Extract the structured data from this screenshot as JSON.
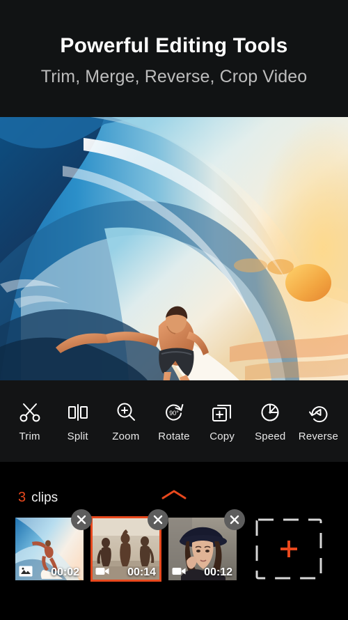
{
  "header": {
    "title": "Powerful Editing Tools",
    "subtitle": "Trim, Merge, Reverse, Crop Video"
  },
  "preview": {
    "alt": "Surfer riding inside a barrel wave at sunset"
  },
  "toolbar": {
    "items": [
      {
        "label": "Trim",
        "icon": "scissors-icon"
      },
      {
        "label": "Split",
        "icon": "split-icon"
      },
      {
        "label": "Zoom",
        "icon": "magnifier-plus-icon"
      },
      {
        "label": "Rotate",
        "icon": "rotate-90-icon"
      },
      {
        "label": "Copy",
        "icon": "copy-plus-icon"
      },
      {
        "label": "Speed",
        "icon": "speedometer-icon"
      },
      {
        "label": "Reverse",
        "icon": "reverse-arrow-icon"
      }
    ]
  },
  "clips_panel": {
    "count": "3",
    "count_word": "clips",
    "collapse_icon": "chevron-up-icon",
    "add_icon": "plus-icon",
    "clips": [
      {
        "duration": "00:02",
        "type_icon": "photo-icon",
        "selected": false,
        "alt": "Surfer on blue wave"
      },
      {
        "duration": "00:14",
        "type_icon": "video-icon",
        "selected": true,
        "alt": "Three people dancing on beach"
      },
      {
        "duration": "00:12",
        "type_icon": "video-icon",
        "selected": false,
        "alt": "Woman wearing a dark hat"
      }
    ]
  },
  "colors": {
    "accent": "#e8481d",
    "header_bg": "#111314",
    "toolbar_bg": "#131415",
    "panel_bg": "#000000",
    "text_primary": "#ffffff",
    "text_secondary": "#bdbdbd"
  }
}
